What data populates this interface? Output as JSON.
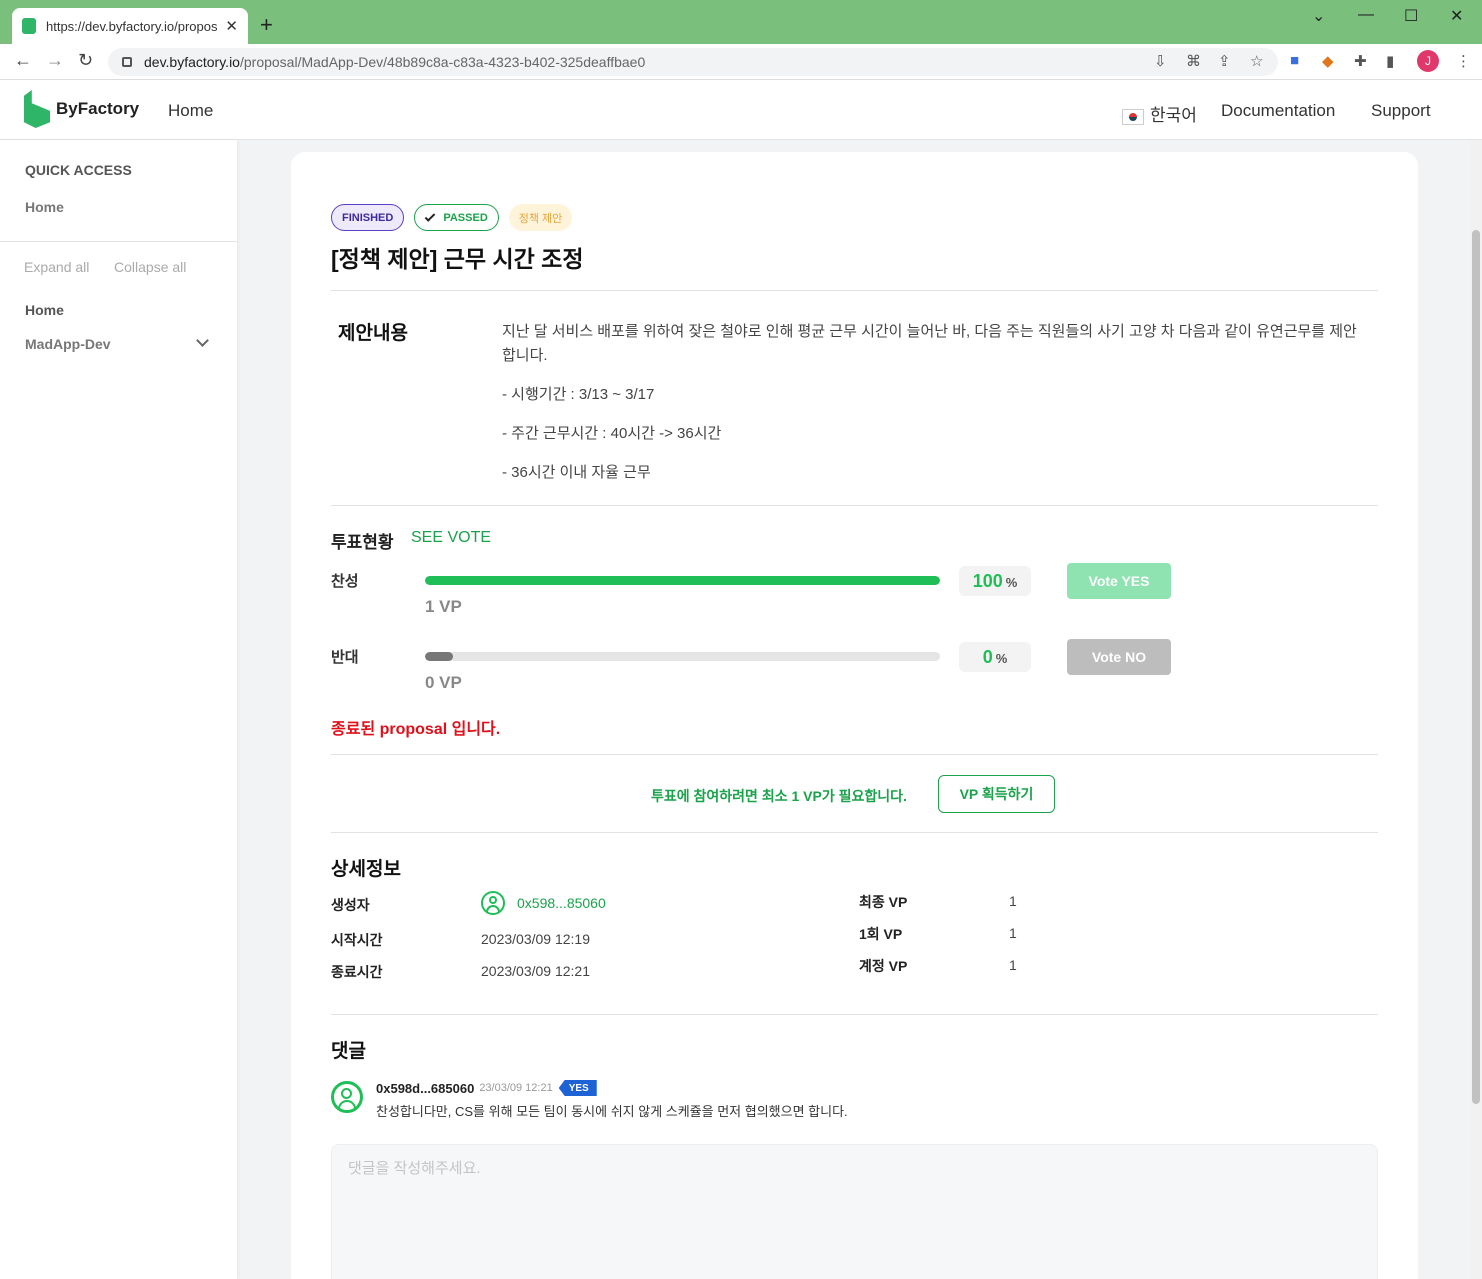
{
  "browser": {
    "tab_title": "https://dev.byfactory.io/proposa",
    "new_tab": "+",
    "url_host": "dev.byfactory.io",
    "url_path": "/proposal/MadApp-Dev/48b89c8a-c83a-4323-b402-325deaffbae0",
    "profile_initial": "J"
  },
  "header": {
    "brand": "ByFactory",
    "home": "Home",
    "language": "한국어",
    "documentation": "Documentation",
    "support": "Support"
  },
  "sidebar": {
    "quick_access": "QUICK ACCESS",
    "quick_home": "Home",
    "expand_all": "Expand all",
    "collapse_all": "Collapse all",
    "home": "Home",
    "madapp": "MadApp-Dev"
  },
  "proposal": {
    "status_badge": "FINISHED",
    "result_badge": "PASSED",
    "category_badge": "정책 제안",
    "title": "[정책 제안] 근무 시간 조정",
    "content_label": "제안내용",
    "content": [
      "지난 달 서비스 배포를 위하여 잦은 철야로 인해 평균 근무 시간이 늘어난 바, 다음 주는 직원들의 사기 고양 차 다음과 같이 유연근무를 제안합니다.",
      "- 시행기간 : 3/13 ~ 3/17",
      "- 주간 근무시간 : 40시간 -> 36시간",
      "- 36시간 이내 자율 근무"
    ]
  },
  "vote": {
    "title": "투표현황",
    "see_vote": "SEE VOTE",
    "yes": {
      "label": "찬성",
      "percent": 100,
      "percent_text": "100",
      "vp": "1 VP",
      "button": "Vote YES",
      "color": "#1fbe57",
      "button_color": "#8ee3b0"
    },
    "no": {
      "label": "반대",
      "percent": 0,
      "percent_text": "0",
      "vp": "0 VP",
      "button": "Vote NO",
      "color": "#777777",
      "button_color": "#bdbdbd"
    },
    "percent_unit": "%",
    "ended_notice": "종료된 proposal 입니다.",
    "need_vp": "투표에 참여하려면 최소 1 VP가 필요합니다.",
    "get_vp": "VP 획득하기"
  },
  "details": {
    "title": "상세정보",
    "creator_label": "생성자",
    "creator": "0x598...85060",
    "start_label": "시작시간",
    "start": "2023/03/09 12:19",
    "end_label": "종료시간",
    "end": "2023/03/09 12:21",
    "final_vp_label": "최종 VP",
    "final_vp": "1",
    "once_vp_label": "1회 VP",
    "once_vp": "1",
    "account_vp_label": "계정 VP",
    "account_vp": "1"
  },
  "comments": {
    "title": "댓글",
    "items": [
      {
        "author": "0x598d...685060",
        "time": "23/03/09 12:21",
        "vote": "YES",
        "text": "찬성합니다만, CS를 위해 모든 팀이 동시에 쉬지 않게 스케쥴을 먼저 협의했으면 합니다."
      }
    ],
    "placeholder": "댓글을 작성해주세요."
  }
}
